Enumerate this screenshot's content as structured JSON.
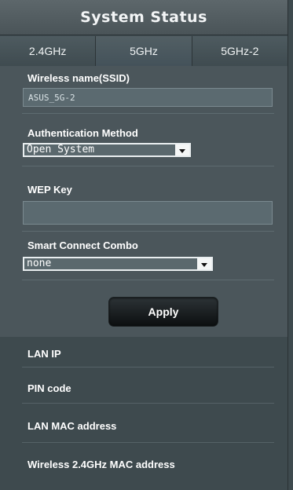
{
  "window": {
    "title": "System Status"
  },
  "tabs": [
    {
      "label": "2.4GHz"
    },
    {
      "label": "5GHz"
    },
    {
      "label": "5GHz-2"
    }
  ],
  "form": {
    "ssid_label": "Wireless name(SSID)",
    "ssid_value": "ASUS_5G-2",
    "auth_label": "Authentication Method",
    "auth_value": "Open System",
    "wep_label": "WEP Key",
    "wep_value": "",
    "smart_connect_label": "Smart Connect Combo",
    "smart_connect_value": "none",
    "apply_label": "Apply"
  },
  "info": {
    "items": [
      {
        "label": "LAN IP"
      },
      {
        "label": "PIN code"
      },
      {
        "label": "LAN MAC address"
      },
      {
        "label": "Wireless 2.4GHz MAC address"
      }
    ]
  },
  "colors": {
    "background": "#3e4a4e",
    "panel": "#4b565b",
    "input_fill": "#5b6a70",
    "button": "#0c0f10"
  }
}
